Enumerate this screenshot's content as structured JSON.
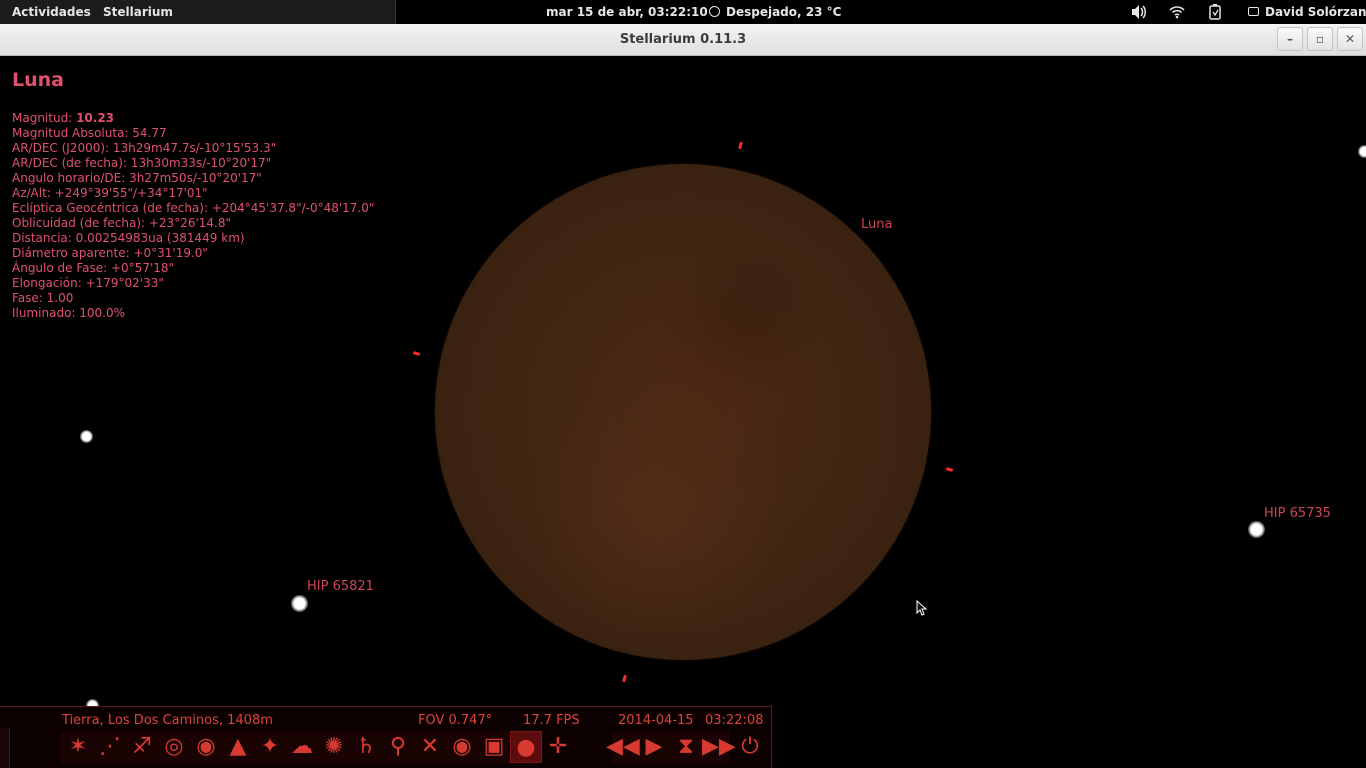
{
  "topbar": {
    "activities": "Actividades",
    "app_menu": "Stellarium",
    "clock": "mar 15 de abr, 03:22:10",
    "weather": "Despejado, 23 °C",
    "user": "David Solórzano"
  },
  "window": {
    "title": "Stellarium 0.11.3",
    "minimize": "–",
    "maximize": "▫",
    "close": "✕"
  },
  "object_info": {
    "name": "Luna",
    "magnitude_label": "Magnitud: ",
    "magnitude_value": "10.23",
    "rows": [
      "Magnitud Absoluta: 54.77",
      "AR/DEC (J2000): 13h29m47.7s/-10°15'53.3\"",
      "AR/DEC (de fecha): 13h30m33s/-10°20'17\"",
      "Angulo horario/DE: 3h27m50s/-10°20'17\"",
      "Az/Alt: +249°39'55\"/+34°17'01\"",
      "Eclíptica Geocéntrica (de fecha): +204°45'37.8\"/-0°48'17.0\"",
      "Oblicuidad (de fecha): +23°26'14.8\"",
      "Distancia: 0.00254983ua (381449 km)",
      "Diámetro aparente: +0°31'19.0\"",
      "Ángulo de Fase: +0°57'18\"",
      "Elongación: +179°02'33\"",
      "Fase: 1.00",
      "Iluminado: 100.0%"
    ]
  },
  "sky_labels": {
    "moon": "Luna",
    "star1": "HIP 65735",
    "star2": "HIP 65821"
  },
  "statusbar": {
    "location": "Tierra, Los Dos Caminos, 1408m",
    "fov": "FOV 0.747°",
    "fps": "17.7 FPS",
    "date": "2014-04-15",
    "time": "03:22:08"
  },
  "colors": {
    "info_text": "#e0516f",
    "toolbar_icon": "#d83a32",
    "moon": "#3e2412"
  }
}
